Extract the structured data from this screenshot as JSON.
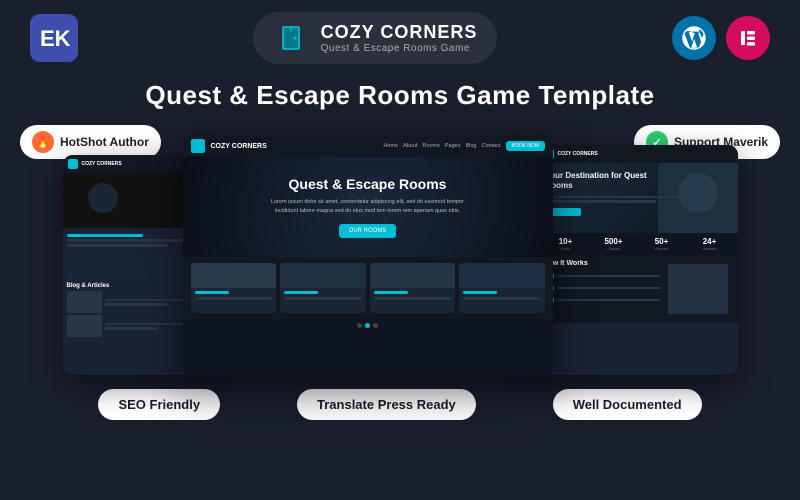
{
  "header": {
    "logo_left_text": "EK",
    "brand_title": "COZY CORNERS",
    "brand_subtitle": "Quest & Escape Rooms Game",
    "wordpress_label": "WordPress",
    "elementor_label": "Elementor"
  },
  "main_title": "Quest & Escape Rooms Game Template",
  "badges": {
    "hotshot_author": "HotShot Author",
    "support_maverik": "Support Maverik"
  },
  "desktop_preview": {
    "nav_brand": "COZY CORNERS",
    "nav_home": "Home",
    "nav_about": "About",
    "nav_rooms": "Rooms",
    "nav_pages": "Pages",
    "nav_blog": "Blog",
    "nav_contact": "Contact",
    "book_btn": "BOOK NOW",
    "hero_title": "Quest & Escape Rooms",
    "hero_text": "Lorem ipsum dolor sit amet, consectetur adipiscing elit, sed do eiusmod tempor incididunt labore magna sed do eius mod tem lorem rem aperiam quas obis.",
    "our_rooms_btn": "OUR ROOMS"
  },
  "bottom_badges": {
    "seo": "SEO Friendly",
    "translate": "Translate Press Ready",
    "documented": "Well Documented"
  }
}
